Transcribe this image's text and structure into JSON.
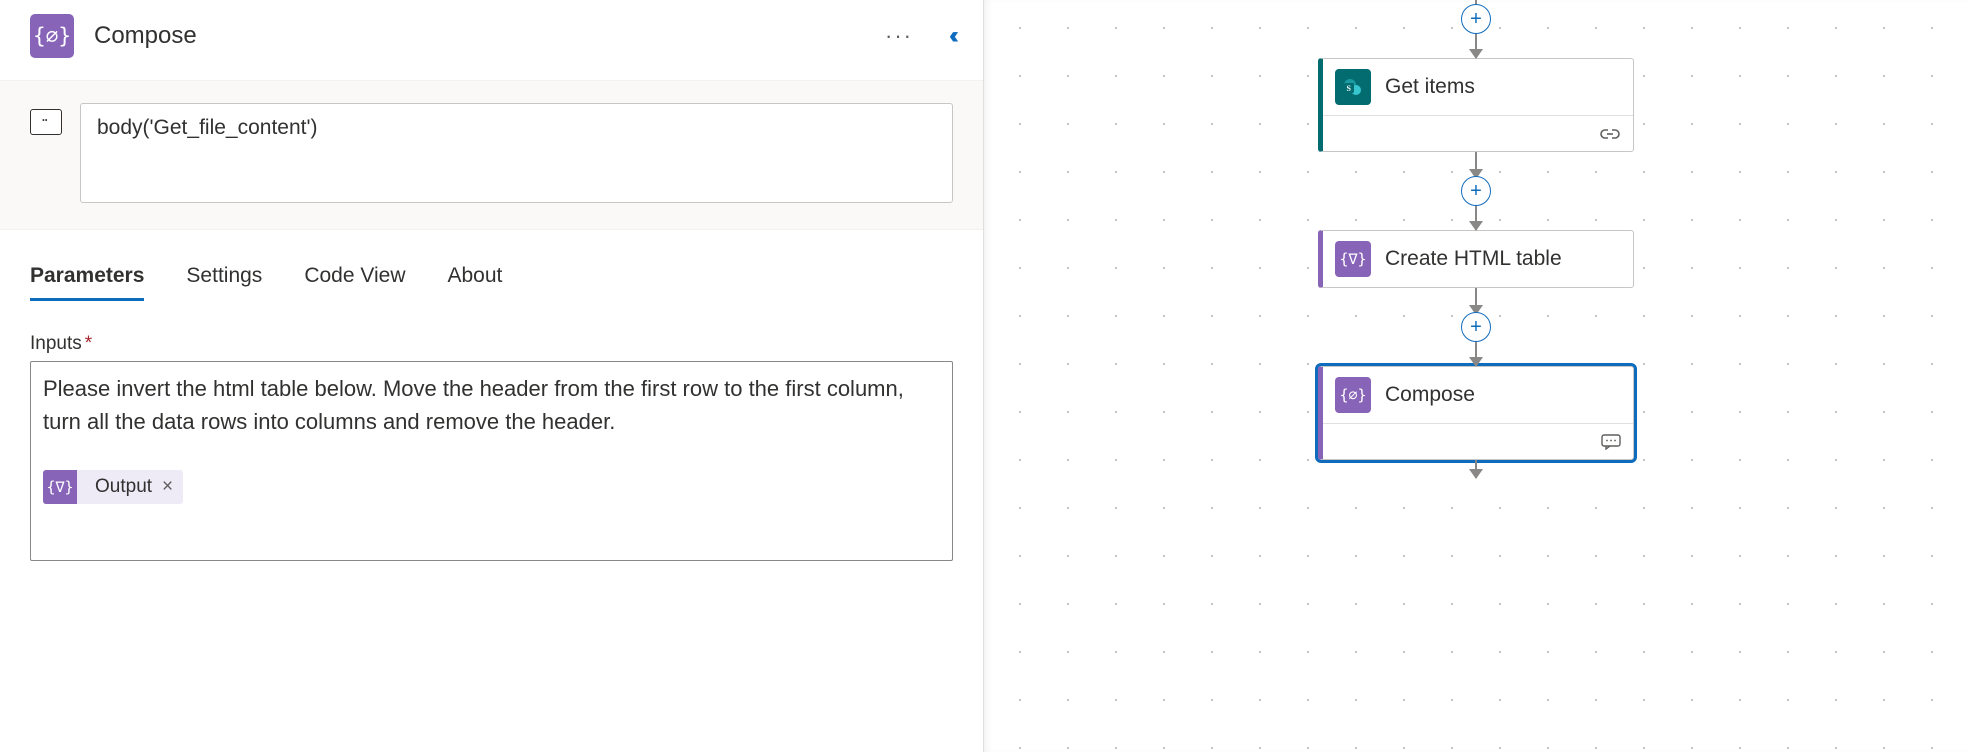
{
  "header": {
    "title": "Compose"
  },
  "expression": {
    "value": "body('Get_file_content')"
  },
  "tabs": [
    {
      "label": "Parameters",
      "active": true
    },
    {
      "label": "Settings"
    },
    {
      "label": "Code View"
    },
    {
      "label": "About"
    }
  ],
  "inputs": {
    "label": "Inputs",
    "required": true,
    "text": "Please invert the html table below. Move the header from the first row to the first column, turn all the data rows into columns and remove the header.",
    "token": {
      "label": "Output"
    }
  },
  "flow": {
    "nodes": [
      {
        "id": "get-items",
        "title": "Get items",
        "kind": "sharepoint",
        "footer": "link"
      },
      {
        "id": "create-html-table",
        "title": "Create HTML table",
        "kind": "operation",
        "footer": "none"
      },
      {
        "id": "compose",
        "title": "Compose",
        "kind": "operation",
        "footer": "comment",
        "selected": true
      }
    ]
  },
  "icons": {
    "more": "···",
    "collapse": "‹‹",
    "plus": "+",
    "close": "×"
  },
  "colors": {
    "accent": "#0F6CBD",
    "operation": "#8764B8",
    "sharepoint": "#036C70"
  }
}
